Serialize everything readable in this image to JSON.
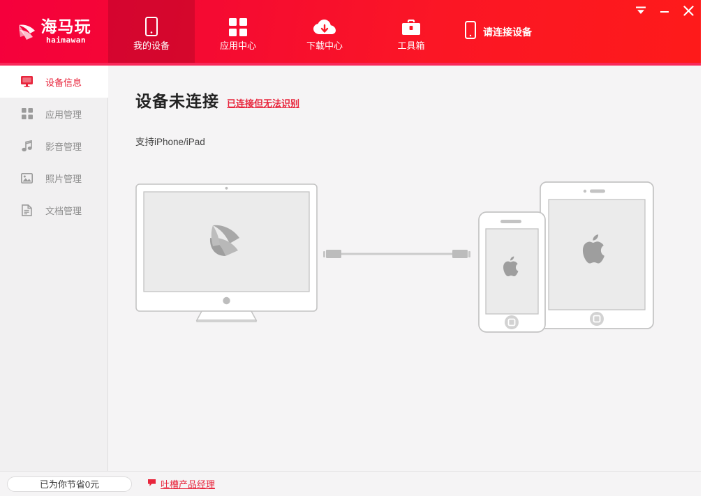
{
  "window": {
    "controls": [
      {
        "name": "menu-button",
        "glyph": "menu-triangle-icon"
      },
      {
        "name": "minimize-button",
        "glyph": "minimize-icon"
      },
      {
        "name": "close-button",
        "glyph": "close-icon"
      }
    ]
  },
  "brand": {
    "logo_cn": "海马玩",
    "logo_en": "haimawan",
    "icon": "seahorse-logo-icon"
  },
  "nav": {
    "tabs": [
      {
        "label": "我的设备",
        "icon": "phone-icon",
        "active": true
      },
      {
        "label": "应用中心",
        "icon": "grid-apps-icon",
        "active": false
      },
      {
        "label": "下载中心",
        "icon": "cloud-download-icon",
        "active": false
      },
      {
        "label": "工具箱",
        "icon": "toolbox-icon",
        "active": false
      }
    ]
  },
  "connect_status": {
    "label": "请连接设备",
    "icon": "phone-outline-icon"
  },
  "sidebar": {
    "items": [
      {
        "label": "设备信息",
        "icon": "monitor-icon",
        "active": true
      },
      {
        "label": "应用管理",
        "icon": "grid-apps-icon",
        "active": false
      },
      {
        "label": "影音管理",
        "icon": "music-note-icon",
        "active": false
      },
      {
        "label": "照片管理",
        "icon": "photo-icon",
        "active": false
      },
      {
        "label": "文档管理",
        "icon": "document-icon",
        "active": false
      }
    ]
  },
  "main": {
    "title": "设备未连接",
    "title_link": "已连接但无法识别",
    "subtitle": "支持iPhone/iPad",
    "illustration": {
      "computer": "imac-monitor-illustration",
      "cable": "usb-cable-illustration",
      "phone": "iphone-illustration",
      "tablet": "ipad-illustration"
    }
  },
  "footer": {
    "savings_label": "已为你节省0元",
    "feedback_label": "吐槽产品经理",
    "feedback_icon": "speech-bubble-icon"
  },
  "colors": {
    "brand_red": "#f5003c",
    "accent_red": "#e8253c",
    "header_gradient_end": "#fe1a1a",
    "sidebar_bg": "#f1f0f1",
    "main_bg": "#f5f4f5",
    "illustration_stroke": "#c3c3c3",
    "illustration_fill": "#ebebeb"
  }
}
